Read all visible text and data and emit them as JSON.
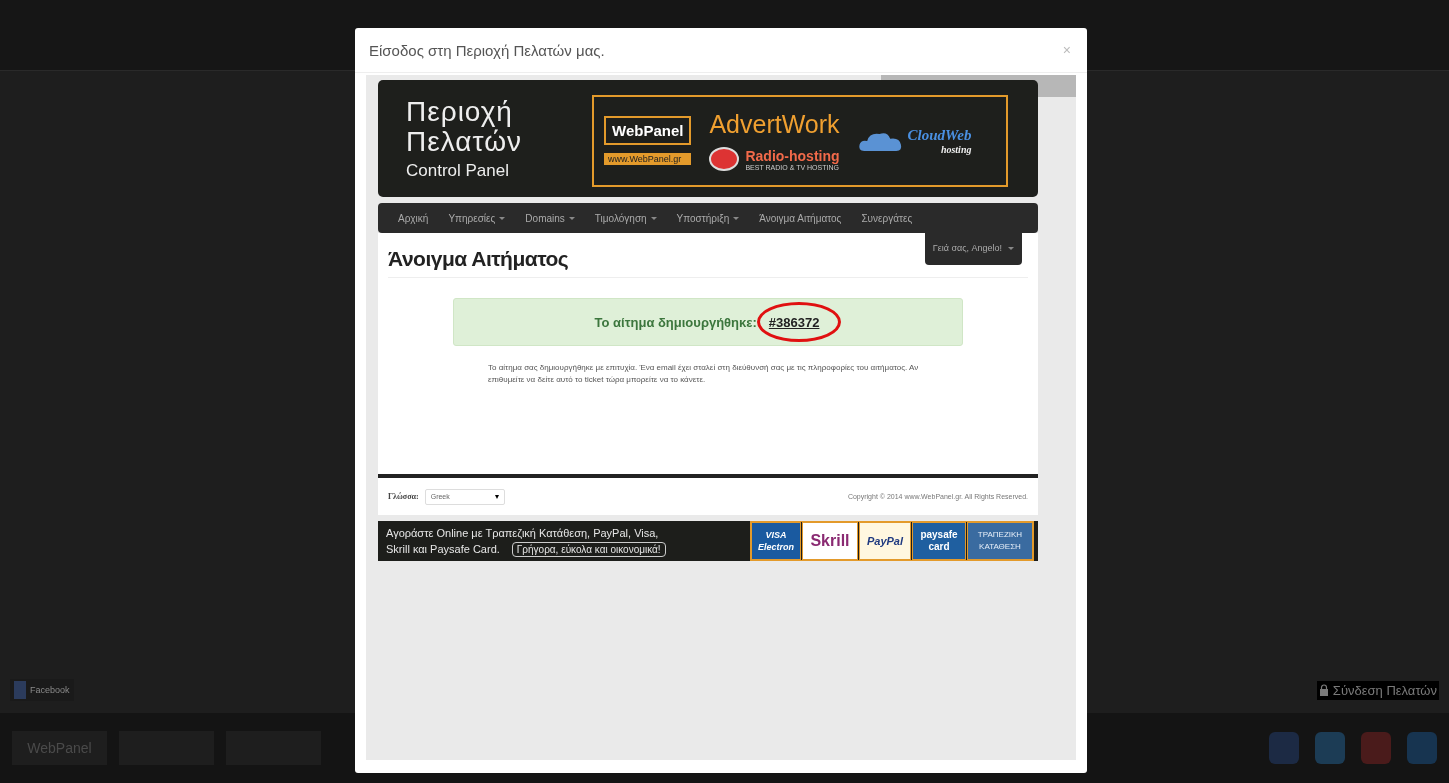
{
  "background": {
    "login_link": "Σύνδεση Πελατών",
    "facebook_label": "Facebook",
    "footer_logo": "WebPanel"
  },
  "modal": {
    "title": "Είσοδος στη Περιοχή Πελατών μας.",
    "close": "×"
  },
  "banner": {
    "title_lines": [
      "Περιοχή",
      "Πελατών"
    ],
    "subtitle": "Control Panel",
    "webpanel": "WebPanel",
    "webpanel_url": "www.WebPanel.gr",
    "advertwork": "AdvertWork",
    "radio": "Radio-hosting",
    "radio_tagline": "BEST RADIO & TV HOSTING",
    "cloud": "CloudWeb",
    "cloud_sub": "hosting"
  },
  "nav": {
    "items": [
      {
        "label": "Αρχική",
        "dropdown": false,
        "selected": false
      },
      {
        "label": "Υπηρεσίες",
        "dropdown": true,
        "selected": false
      },
      {
        "label": "Domains",
        "dropdown": true,
        "selected": false
      },
      {
        "label": "Τιμολόγηση",
        "dropdown": true,
        "selected": false
      },
      {
        "label": "Υποστήριξη",
        "dropdown": true,
        "selected": false
      },
      {
        "label": "Άνοιγμα Αιτήματος",
        "dropdown": false,
        "selected": false
      },
      {
        "label": "Συνεργάτες",
        "dropdown": false,
        "selected": false
      }
    ],
    "user_menu": "Γειά σας, Angelo!"
  },
  "page": {
    "heading": "Άνοιγμα Αιτήματος",
    "alert_text": "Το αίτημα δημιουργήθηκε:",
    "ticket_number": "#386372",
    "message": "Το αίτημα σας δημιουργήθηκε με επιτυχία. Ένα email έχει σταλεί στη διεύθυνσή σας με τις πληροφορίες του αιτήματος. Αν επιθυμείτε να δείτε αυτό το ticket τώρα μπορείτε να το κάνετε."
  },
  "footer": {
    "language_label": "Γλώσσα:",
    "language_value": "Greek",
    "copyright": "Copyright © 2014 www.WebPanel.gr. All Rights Reserved."
  },
  "payment_banner": {
    "lines": [
      "Αγοράστε Online με Τραπεζική Κατάθεση, PayPal, Visa,",
      "Skrill και Paysafe Card."
    ],
    "slogan": "Γρήγορα, εύκολα και οικονομικά!",
    "logos": [
      {
        "kind": "visa",
        "lines": [
          "VISA",
          "Electron"
        ]
      },
      {
        "kind": "skrill",
        "lines": [
          "Skrill"
        ]
      },
      {
        "kind": "paypal",
        "lines": [
          "PayPal"
        ]
      },
      {
        "kind": "paysafe",
        "lines": [
          "paysafe",
          "card"
        ]
      },
      {
        "kind": "bank",
        "lines": [
          "ΤΡΑΠΕΖΙΚΗ",
          "ΚΑΤΑΘΕΣΗ"
        ]
      }
    ]
  }
}
